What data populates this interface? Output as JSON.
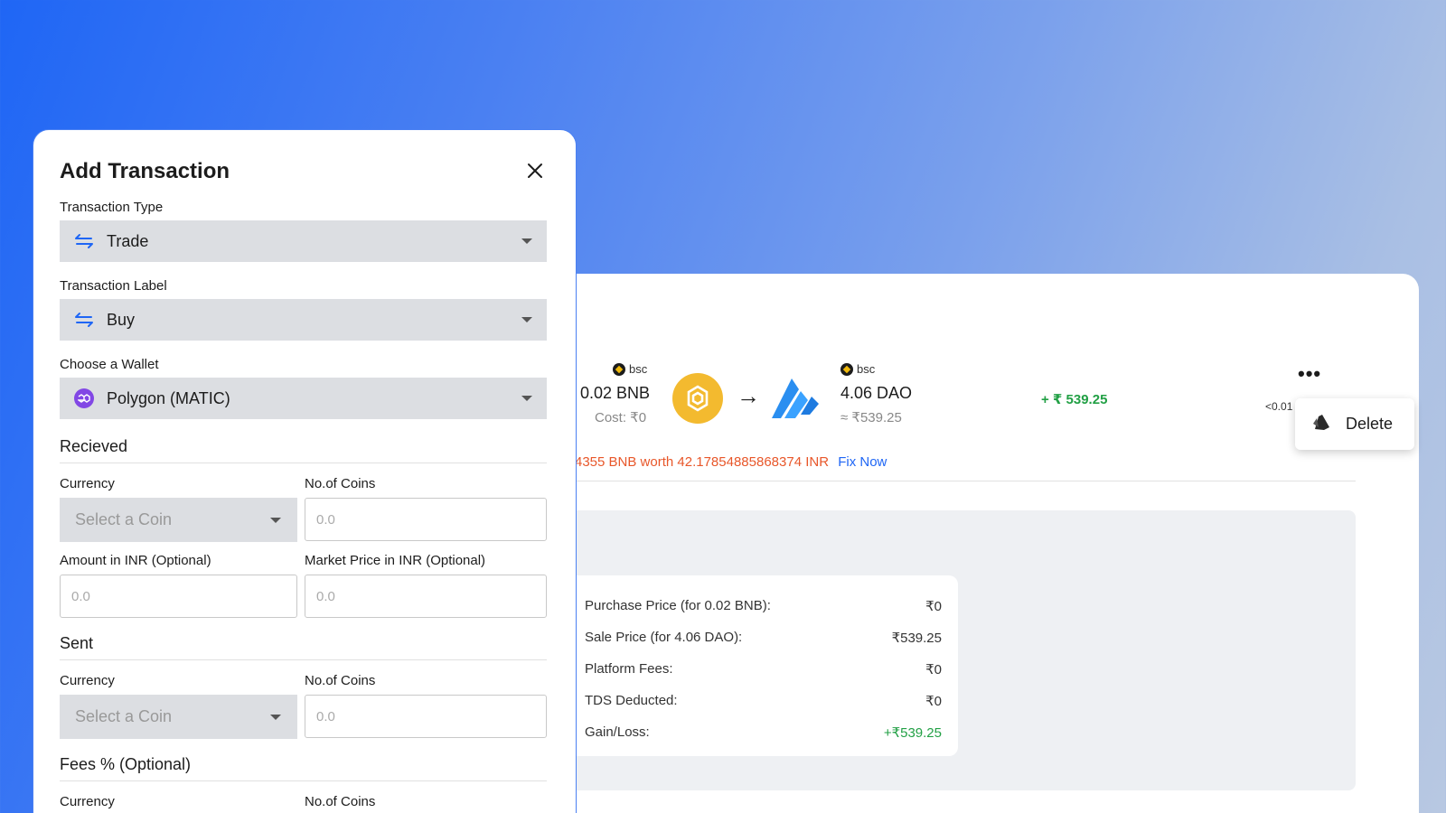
{
  "background_tx": {
    "from_chain": "bsc",
    "from_amount": "0.02 BNB",
    "from_cost": "Cost: ₹0",
    "to_chain": "bsc",
    "to_amount": "4.06 DAO",
    "to_value": "≈ ₹539.25",
    "gain": "+ ₹ 539.25",
    "more_label": "•••",
    "small_value": "<0.01",
    "warning_text": "4355 BNB worth 42.17854885868374 INR",
    "fix_label": "Fix Now",
    "summary": [
      {
        "label": "Purchase Price (for 0.02 BNB):",
        "value": "₹0"
      },
      {
        "label": "Sale Price (for 4.06 DAO):",
        "value": "₹539.25"
      },
      {
        "label": "Platform Fees:",
        "value": "₹0"
      },
      {
        "label": "TDS Deducted:",
        "value": "₹0"
      },
      {
        "label": "Gain/Loss:",
        "value": "+₹539.25"
      }
    ]
  },
  "popover": {
    "delete_label": "Delete"
  },
  "modal": {
    "title": "Add Transaction",
    "transaction_type": {
      "label": "Transaction Type",
      "value": "Trade"
    },
    "transaction_label": {
      "label": "Transaction Label",
      "value": "Buy"
    },
    "wallet": {
      "label": "Choose a Wallet",
      "value": "Polygon (MATIC)"
    },
    "received": {
      "heading": "Recieved",
      "currency_label": "Currency",
      "currency_placeholder": "Select a Coin",
      "coins_label": "No.of Coins",
      "coins_placeholder": "0.0",
      "amount_label": "Amount in INR (Optional)",
      "amount_placeholder": "0.0",
      "market_label": "Market Price in INR (Optional)",
      "market_placeholder": "0.0"
    },
    "sent": {
      "heading": "Sent",
      "currency_label": "Currency",
      "currency_placeholder": "Select a Coin",
      "coins_label": "No.of Coins",
      "coins_placeholder": "0.0"
    },
    "fees": {
      "heading": "Fees % (Optional)",
      "currency_label": "Currency",
      "coins_label": "No.of Coins"
    }
  },
  "colors": {
    "accent": "#1f66f5",
    "gain": "#22a045",
    "warning": "#e8572a",
    "bnb": "#f3ba2f",
    "matic": "#8247e5"
  }
}
